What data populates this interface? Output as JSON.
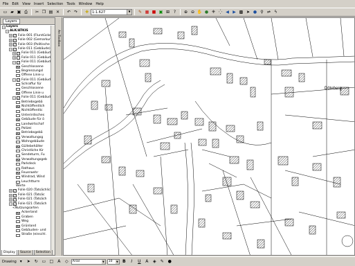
{
  "menu": [
    "File",
    "Edit",
    "View",
    "Insert",
    "Selection",
    "Tools",
    "Window",
    "Help"
  ],
  "toolbar": {
    "scale": "1:1.627"
  },
  "toc": {
    "tab_label": "Layers",
    "rows": [
      {
        "indent": 0,
        "exp": "-",
        "chk": "",
        "text": "Layers",
        "kind": "root"
      },
      {
        "indent": 1,
        "exp": "-",
        "chk": "",
        "text": "ALK/ATKIS",
        "kind": "group"
      },
      {
        "indent": 2,
        "exp": "+",
        "chk": "✓",
        "text": "Folie 001 (Flurstücke)"
      },
      {
        "indent": 2,
        "exp": "+",
        "chk": "✓",
        "text": "Folie 002 (Gemarkung)"
      },
      {
        "indent": 2,
        "exp": "+",
        "chk": "✓",
        "text": "Folie 003 (Politische G"
      },
      {
        "indent": 2,
        "exp": "-",
        "chk": "✓",
        "text": "Folie 011 (Gebäude)"
      },
      {
        "indent": 3,
        "exp": "+",
        "chk": "✓",
        "text": "Folie 011 (Gebäud"
      },
      {
        "indent": 3,
        "exp": "+",
        "chk": "",
        "text": "Folie 011 (Gebäud"
      },
      {
        "indent": 3,
        "exp": "-",
        "chk": "✓",
        "text": "Folie 011 (Gebäud"
      },
      {
        "indent": 4,
        "exp": "",
        "chk": "",
        "text": "Geschlossene",
        "sw": "1"
      },
      {
        "indent": 4,
        "exp": "",
        "chk": "",
        "text": "Begrenzungsl",
        "sw": "1"
      },
      {
        "indent": 4,
        "exp": "",
        "chk": "",
        "text": "Offene Linie u",
        "sw": "1"
      },
      {
        "indent": 3,
        "exp": "-",
        "chk": "✓",
        "text": "Folie 011 (Gebäud"
      },
      {
        "indent": 4,
        "exp": "",
        "chk": "",
        "text": "Schraffur für",
        "sw": "1"
      },
      {
        "indent": 4,
        "exp": "",
        "chk": "",
        "text": "Geschlossene",
        "sw": "1"
      },
      {
        "indent": 4,
        "exp": "",
        "chk": "",
        "text": "Offene Linie u",
        "sw": "1"
      },
      {
        "indent": 3,
        "exp": "-",
        "chk": "✓",
        "text": "Folie 011 (Gebäud"
      },
      {
        "indent": 4,
        "exp": "",
        "chk": "",
        "text": "Betriebsgebä",
        "sw": "1"
      },
      {
        "indent": 4,
        "exp": "",
        "chk": "",
        "text": "Nichtöffentlich",
        "sw": "1"
      },
      {
        "indent": 4,
        "exp": "",
        "chk": "",
        "text": "Nichtöffentlic",
        "sw": "1"
      },
      {
        "indent": 4,
        "exp": "",
        "chk": "",
        "text": "Unterirdisches",
        "sw": "1"
      },
      {
        "indent": 4,
        "exp": "",
        "chk": "",
        "text": "Gebäude für ö",
        "sw": "1"
      },
      {
        "indent": 4,
        "exp": "",
        "chk": "",
        "text": "Landwirtschaf",
        "sw": "1"
      },
      {
        "indent": 4,
        "exp": "",
        "chk": "",
        "text": "Polizei",
        "sw": "1"
      },
      {
        "indent": 4,
        "exp": "",
        "chk": "",
        "text": "Betriebsgebä",
        "sw": "1"
      },
      {
        "indent": 4,
        "exp": "",
        "chk": "",
        "text": "Verwaltungsg",
        "sw": "1"
      },
      {
        "indent": 4,
        "exp": "",
        "chk": "",
        "text": "Wohngebäude",
        "sw": "1"
      },
      {
        "indent": 4,
        "exp": "",
        "chk": "",
        "text": "Güllebehälter",
        "sw": "1"
      },
      {
        "indent": 4,
        "exp": "",
        "chk": "",
        "text": "Christliche Kir",
        "sw": "1"
      },
      {
        "indent": 4,
        "exp": "",
        "chk": "",
        "text": "Sendeturm, Fu",
        "sw": "1"
      },
      {
        "indent": 4,
        "exp": "",
        "chk": "",
        "text": "Verwaltungsgeb",
        "sw": "1"
      },
      {
        "indent": 4,
        "exp": "",
        "chk": "",
        "text": "Parkdeck",
        "sw": "1"
      },
      {
        "indent": 4,
        "exp": "",
        "chk": "",
        "text": "Rathaus",
        "sw": "1"
      },
      {
        "indent": 4,
        "exp": "",
        "chk": "",
        "text": "Feuerwehr",
        "sw": "1"
      },
      {
        "indent": 4,
        "exp": "",
        "chk": "",
        "text": "Windrad, Wind",
        "sw": "1"
      },
      {
        "indent": 4,
        "exp": "",
        "chk": "",
        "text": "Leuchtturm",
        "sw": "1"
      },
      {
        "indent": 4,
        "exp": "",
        "chk": "",
        "text": "Werte",
        "sw": "0"
      },
      {
        "indent": 2,
        "exp": "+",
        "chk": "✓",
        "text": "Folie 020 (Tatsächliche"
      },
      {
        "indent": 2,
        "exp": "+",
        "chk": "✓",
        "text": "Folie 021 (Tatsäc"
      },
      {
        "indent": 2,
        "exp": "+",
        "chk": "✓",
        "text": "Folie 021 (Tatsäch"
      },
      {
        "indent": 2,
        "exp": "-",
        "chk": "✓",
        "text": "Folie 021 (Tatsäch"
      },
      {
        "indent": 3,
        "exp": "",
        "chk": "",
        "text": "<Nutzungsarten",
        "sw": "0"
      },
      {
        "indent": 4,
        "exp": "",
        "chk": "",
        "text": "Ackerland",
        "sw": "1"
      },
      {
        "indent": 4,
        "exp": "",
        "chk": "",
        "text": "Graben",
        "sw": "1"
      },
      {
        "indent": 4,
        "exp": "",
        "chk": "",
        "text": "Weg",
        "sw": "1"
      },
      {
        "indent": 4,
        "exp": "",
        "chk": "",
        "text": "Grünland",
        "sw": "1"
      },
      {
        "indent": 4,
        "exp": "",
        "chk": "",
        "text": "Gebäuden- und",
        "sw": "1"
      },
      {
        "indent": 4,
        "exp": "",
        "chk": "",
        "text": "Straße (einschl.",
        "sw": "1"
      }
    ],
    "tabs": [
      "Display",
      "Source",
      "Selection"
    ]
  },
  "side_strip_label": "ArcToolbox",
  "map": {
    "place_label": "Döteberg"
  },
  "drawing": {
    "label": "Drawing",
    "font": "Arial",
    "size": "10"
  },
  "colors": {
    "chrome": "#d4d0c8",
    "map_bg": "#ffffff",
    "line": "#000000"
  }
}
